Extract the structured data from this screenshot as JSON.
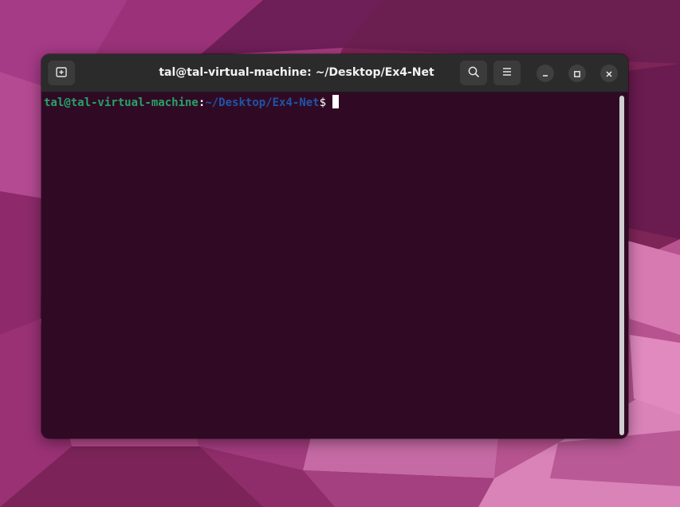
{
  "window": {
    "title": "tal@tal-virtual-machine: ~/Desktop/Ex4-Net"
  },
  "header": {
    "new_tab_icon": "new-tab-icon",
    "search_icon": "search-icon",
    "menu_icon": "hamburger-menu-icon",
    "minimize_icon": "minimize-icon",
    "maximize_icon": "maximize-icon",
    "close_icon": "close-icon"
  },
  "terminal": {
    "prompt_user": "tal@tal-virtual-machine",
    "prompt_separator": ":",
    "prompt_path": "~/Desktop/Ex4-Net",
    "prompt_sigil": "$ "
  },
  "colors": {
    "terminal_background": "#300a24",
    "prompt_user": "#26a269",
    "prompt_path": "#1f54a8",
    "header_background": "#2b2b2b",
    "desktop_accent": "#8a2a6e"
  }
}
